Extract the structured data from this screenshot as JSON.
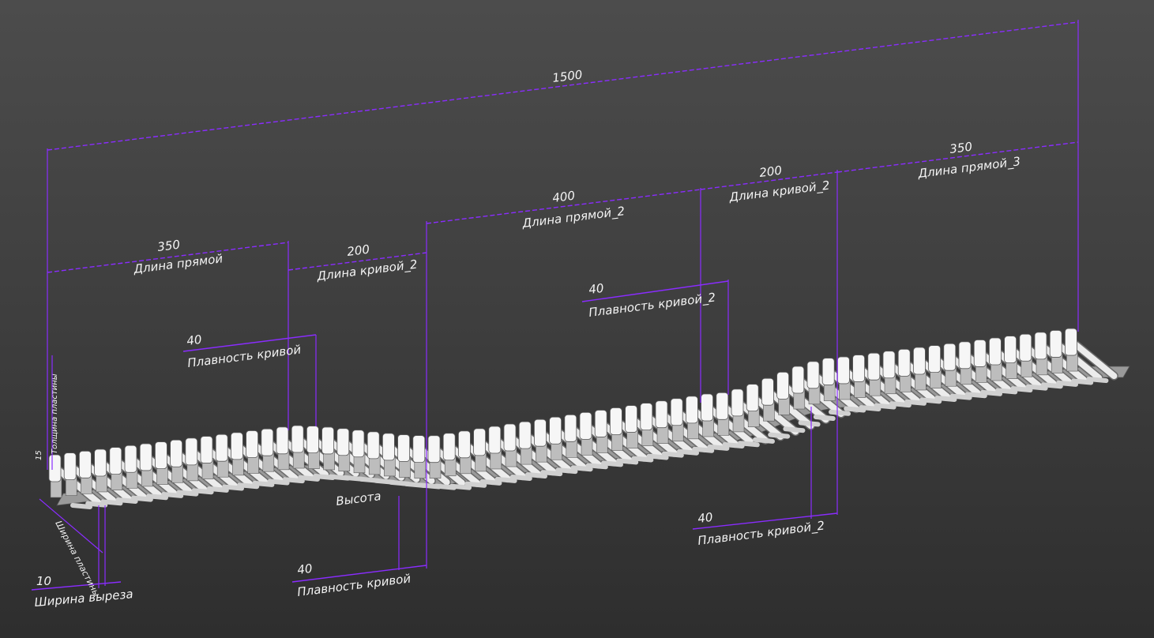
{
  "viewport": {
    "background": "#383838",
    "dimension_color": "#7b22ff"
  },
  "dimensions": {
    "total": {
      "value": "1500"
    },
    "straight_1": {
      "value": "350",
      "label": "Длина прямой"
    },
    "curve_1": {
      "value": "200",
      "label": "Длина кривой_2"
    },
    "straight_2": {
      "value": "400",
      "label": "Длина прямой_2"
    },
    "curve_2": {
      "value": "200",
      "label": "Длина кривой_2"
    },
    "straight_3": {
      "value": "350",
      "label": "Длина прямой_3"
    },
    "smooth_1_top": {
      "value": "40",
      "label": "Плавность кривой"
    },
    "smooth_2_top": {
      "value": "40",
      "label": "Плавность кривой_2"
    },
    "smooth_1_bottom": {
      "value": "40",
      "label": "Плавность кривой"
    },
    "smooth_2_bottom": {
      "value": "40",
      "label": "Плавность кривой_2"
    },
    "cut_width": {
      "value": "10",
      "label": "Ширина выреза"
    },
    "height": {
      "label": "Высота"
    },
    "plate_width": {
      "label": "Ширина пластины"
    },
    "plate_thickness": {
      "value": "15",
      "label": "Толщина пластины"
    }
  }
}
